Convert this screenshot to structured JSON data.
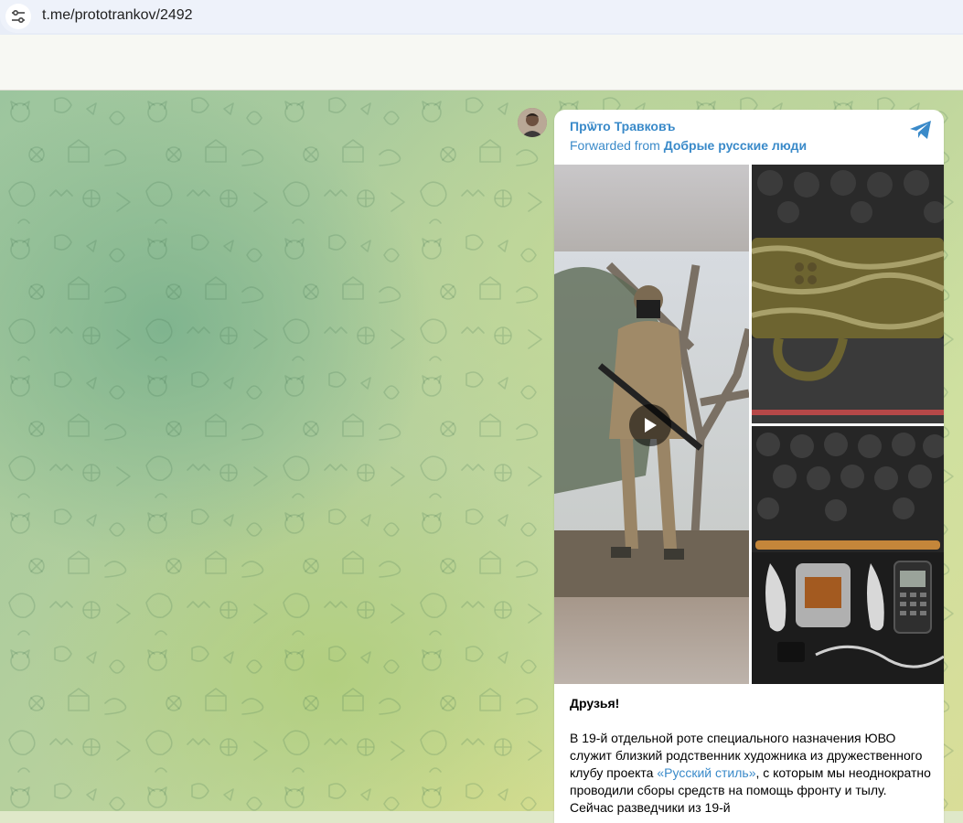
{
  "browser": {
    "url": "t.me/prototrankov/2492",
    "site_icon": "tune-icon"
  },
  "message": {
    "author": "Прѿто Травковъ",
    "forwarded_prefix": "Forwarded from",
    "forwarded_from": "Добрые русские люди",
    "share_icon": "telegram-plane-icon",
    "media": [
      {
        "kind": "video",
        "icon": "play-icon"
      },
      {
        "kind": "photo"
      },
      {
        "kind": "photo"
      }
    ],
    "greeting": "Друзья!",
    "body_before_link": "В 19-й отдельной роте специального назначения ЮВО служит близкий родственник художника из дружественного клубу проекта ",
    "body_link": "«Русский стиль»",
    "body_after_link": ", с которым мы неоднократно проводили сборы средств на помощь фронту и тылу. Сейчас разведчики из 19-й"
  },
  "colors": {
    "accent": "#3a8ac9",
    "bubble": "#ffffff",
    "header": "#f7f8f3"
  }
}
